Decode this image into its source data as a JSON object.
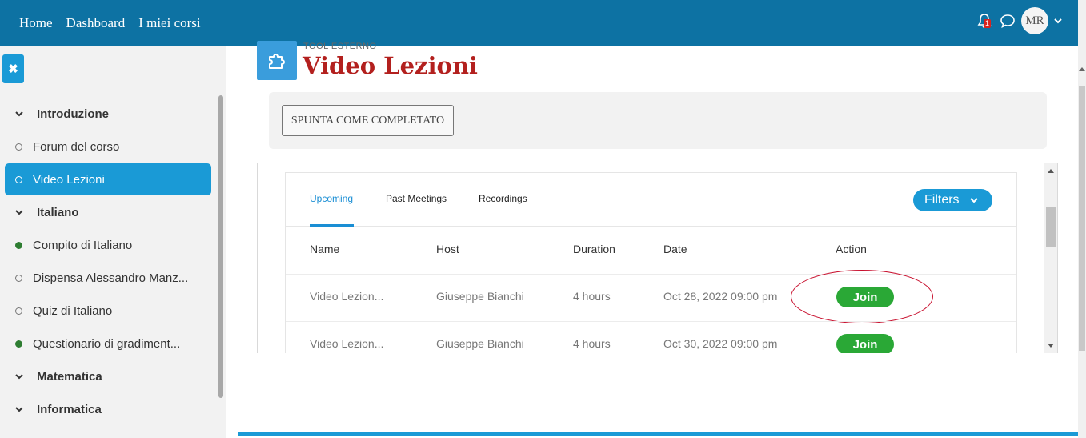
{
  "navbar": {
    "links": [
      "Home",
      "Dashboard",
      "I miei corsi"
    ],
    "notification_count": "1",
    "avatar_initials": "MR",
    "bar_color": "#0d72a3"
  },
  "sidebar": {
    "close_icon": "close-icon",
    "items": [
      {
        "label": "Introduzione",
        "type": "section"
      },
      {
        "label": "Forum del corso",
        "type": "activity",
        "status": "incomplete"
      },
      {
        "label": "Video Lezioni",
        "type": "activity",
        "status": "incomplete",
        "active": true
      },
      {
        "label": "Italiano",
        "type": "section"
      },
      {
        "label": "Compito di Italiano",
        "type": "activity",
        "status": "complete"
      },
      {
        "label": "Dispensa Alessandro Manz...",
        "type": "activity",
        "status": "incomplete"
      },
      {
        "label": "Quiz di Italiano",
        "type": "activity",
        "status": "incomplete"
      },
      {
        "label": "Questionario di gradiment...",
        "type": "activity",
        "status": "complete"
      },
      {
        "label": "Matematica",
        "type": "section"
      },
      {
        "label": "Informatica",
        "type": "section"
      }
    ],
    "active_color": "#1a9ad6"
  },
  "page": {
    "pretitle": "TOOL ESTERNO",
    "title": "Video Lezioni",
    "title_color": "#b3201e",
    "complete_button": "SPUNTA COME COMPLETATO"
  },
  "meetings": {
    "tabs": [
      "Upcoming",
      "Past Meetings",
      "Recordings"
    ],
    "active_tab": "Upcoming",
    "filters_label": "Filters",
    "columns": [
      "Name",
      "Host",
      "Duration",
      "Date",
      "Action"
    ],
    "rows": [
      {
        "name": "Video Lezion...",
        "host": "Giuseppe Bianchi",
        "duration": "4 hours",
        "date": "Oct 28, 2022 09:00 pm",
        "action": "Join"
      },
      {
        "name": "Video Lezion...",
        "host": "Giuseppe Bianchi",
        "duration": "4 hours",
        "date": "Oct 30, 2022 09:00 pm",
        "action": "Join"
      }
    ],
    "join_color": "#2aa836",
    "accent_color": "#1a8ed4"
  }
}
